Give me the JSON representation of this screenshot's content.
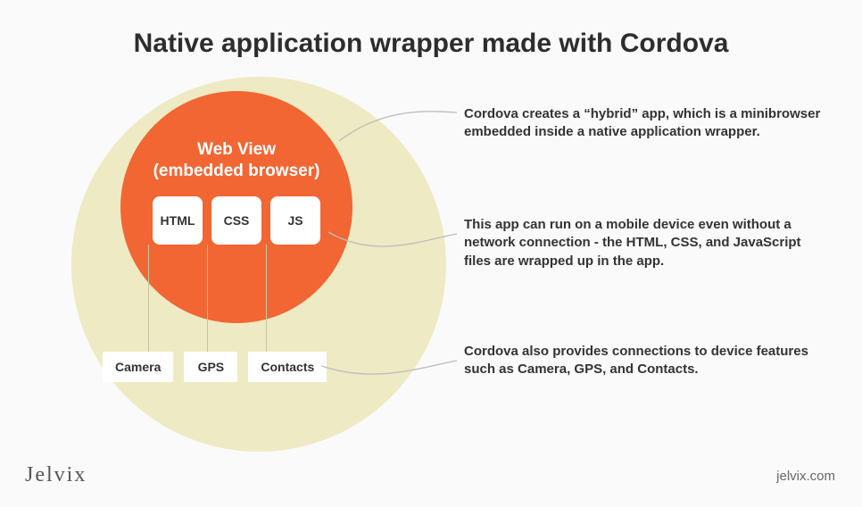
{
  "title": "Native application wrapper made with Cordova",
  "webview": {
    "line1": "Web View",
    "line2": "(embedded browser)"
  },
  "tech": {
    "html": "HTML",
    "css": "CSS",
    "js": "JS"
  },
  "features": {
    "camera": "Camera",
    "gps": "GPS",
    "contacts": "Contacts"
  },
  "descriptions": {
    "d1": "Cordova creates a “hybrid” app, which is a minibrowser embedded inside a native application wrapper.",
    "d2": "This app can run on a mobile device even without a network connection - the HTML, CSS, and JavaScript files are wrapped up in the app.",
    "d3": "Cordova also provides connections to device features such as Camera, GPS, and Contacts."
  },
  "footer": {
    "brand": "Jelvix",
    "site": "jelvix.com"
  }
}
